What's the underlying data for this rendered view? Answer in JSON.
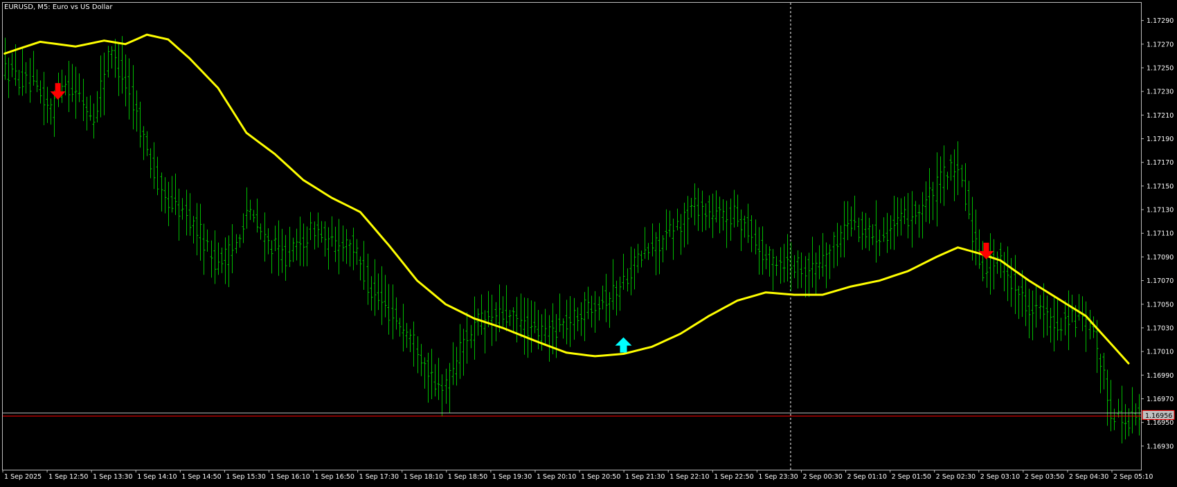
{
  "window": {
    "title": "EURUSD, M5:  Euro vs US Dollar"
  },
  "colors": {
    "background": "#000000",
    "frame": "#c0c0c0",
    "bars": "#00c000",
    "moving_average": "#ffff00",
    "bid_line": "#ff0000",
    "ask_line": "#c0c0c0",
    "price_tag_bg": "#c0c0c0",
    "price_tag_border": "#ff0000",
    "buy_arrow": "#00ffff",
    "sell_arrow": "#ff0000",
    "period_separator": "#ffffff"
  },
  "chart_data": {
    "type": "ohlc",
    "symbol": "EURUSD",
    "timeframe": "M5",
    "ylim": [
      1.1691,
      1.17305
    ],
    "y_ticks": [
      "1.17290",
      "1.17270",
      "1.17250",
      "1.17230",
      "1.17210",
      "1.17190",
      "1.17170",
      "1.17150",
      "1.17130",
      "1.17110",
      "1.17090",
      "1.17070",
      "1.17050",
      "1.17030",
      "1.17010",
      "1.16990",
      "1.16970",
      "1.16950",
      "1.16930"
    ],
    "x_tick_labels": [
      "1 Sep 2025",
      "1 Sep 12:50",
      "1 Sep 13:30",
      "1 Sep 14:10",
      "1 Sep 14:50",
      "1 Sep 15:30",
      "1 Sep 16:10",
      "1 Sep 16:50",
      "1 Sep 17:30",
      "1 Sep 18:10",
      "1 Sep 18:50",
      "1 Sep 19:30",
      "1 Sep 20:10",
      "1 Sep 20:50",
      "1 Sep 21:30",
      "1 Sep 22:10",
      "1 Sep 22:50",
      "1 Sep 23:30",
      "2 Sep 00:30",
      "2 Sep 01:10",
      "2 Sep 01:50",
      "2 Sep 02:30",
      "2 Sep 03:10",
      "2 Sep 03:50",
      "2 Sep 04:30",
      "2 Sep 05:10"
    ],
    "current_price": "1.16956",
    "bid": 1.16956,
    "ask": 1.16958,
    "period_separator_time": "2 Sep 00:00",
    "bars_anchor": [
      {
        "t": 0,
        "p": 1.1725
      },
      {
        "t": 8,
        "p": 1.17235
      },
      {
        "t": 14,
        "p": 1.17215
      },
      {
        "t": 17,
        "p": 1.1724
      },
      {
        "t": 22,
        "p": 1.17225
      },
      {
        "t": 26,
        "p": 1.17205
      },
      {
        "t": 30,
        "p": 1.17265
      },
      {
        "t": 34,
        "p": 1.17245
      },
      {
        "t": 38,
        "p": 1.1721
      },
      {
        "t": 42,
        "p": 1.1717
      },
      {
        "t": 45,
        "p": 1.1714
      },
      {
        "t": 50,
        "p": 1.1713
      },
      {
        "t": 56,
        "p": 1.1711
      },
      {
        "t": 60,
        "p": 1.17085
      },
      {
        "t": 65,
        "p": 1.17095
      },
      {
        "t": 69,
        "p": 1.1713
      },
      {
        "t": 74,
        "p": 1.17105
      },
      {
        "t": 80,
        "p": 1.1709
      },
      {
        "t": 84,
        "p": 1.171
      },
      {
        "t": 88,
        "p": 1.17115
      },
      {
        "t": 92,
        "p": 1.171
      },
      {
        "t": 98,
        "p": 1.17105
      },
      {
        "t": 104,
        "p": 1.1706
      },
      {
        "t": 110,
        "p": 1.1704
      },
      {
        "t": 116,
        "p": 1.1702
      },
      {
        "t": 120,
        "p": 1.16995
      },
      {
        "t": 122,
        "p": 1.16975
      },
      {
        "t": 126,
        "p": 1.1699
      },
      {
        "t": 130,
        "p": 1.1702
      },
      {
        "t": 134,
        "p": 1.17035
      },
      {
        "t": 140,
        "p": 1.1704
      },
      {
        "t": 146,
        "p": 1.17035
      },
      {
        "t": 150,
        "p": 1.17025
      },
      {
        "t": 156,
        "p": 1.1703
      },
      {
        "t": 160,
        "p": 1.17035
      },
      {
        "t": 165,
        "p": 1.1705
      },
      {
        "t": 170,
        "p": 1.17055
      },
      {
        "t": 174,
        "p": 1.17065
      },
      {
        "t": 178,
        "p": 1.17085
      },
      {
        "t": 184,
        "p": 1.171
      },
      {
        "t": 190,
        "p": 1.17115
      },
      {
        "t": 195,
        "p": 1.17135
      },
      {
        "t": 200,
        "p": 1.17125
      },
      {
        "t": 206,
        "p": 1.17125
      },
      {
        "t": 210,
        "p": 1.17115
      },
      {
        "t": 214,
        "p": 1.1709
      },
      {
        "t": 222,
        "p": 1.17085
      },
      {
        "t": 228,
        "p": 1.1708
      },
      {
        "t": 234,
        "p": 1.171
      },
      {
        "t": 238,
        "p": 1.1712
      },
      {
        "t": 243,
        "p": 1.1711
      },
      {
        "t": 248,
        "p": 1.1711
      },
      {
        "t": 253,
        "p": 1.1712
      },
      {
        "t": 258,
        "p": 1.1713
      },
      {
        "t": 262,
        "p": 1.17145
      },
      {
        "t": 266,
        "p": 1.17165
      },
      {
        "t": 270,
        "p": 1.17155
      },
      {
        "t": 273,
        "p": 1.1711
      },
      {
        "t": 276,
        "p": 1.1708
      },
      {
        "t": 280,
        "p": 1.1709
      },
      {
        "t": 284,
        "p": 1.1707
      },
      {
        "t": 288,
        "p": 1.1705
      },
      {
        "t": 292,
        "p": 1.17045
      },
      {
        "t": 296,
        "p": 1.1703
      },
      {
        "t": 300,
        "p": 1.1704
      },
      {
        "t": 304,
        "p": 1.17035
      },
      {
        "t": 306,
        "p": 1.1703
      },
      {
        "t": 309,
        "p": 1.17
      },
      {
        "t": 312,
        "p": 1.1696
      },
      {
        "t": 316,
        "p": 1.1695
      },
      {
        "t": 318,
        "p": 1.16955
      }
    ],
    "moving_average": [
      {
        "t": 0,
        "p": 1.17262
      },
      {
        "t": 10,
        "p": 1.17272
      },
      {
        "t": 20,
        "p": 1.17268
      },
      {
        "t": 28,
        "p": 1.17273
      },
      {
        "t": 34,
        "p": 1.1727
      },
      {
        "t": 40,
        "p": 1.17278
      },
      {
        "t": 46,
        "p": 1.17274
      },
      {
        "t": 52,
        "p": 1.17258
      },
      {
        "t": 60,
        "p": 1.17233
      },
      {
        "t": 68,
        "p": 1.17195
      },
      {
        "t": 76,
        "p": 1.17177
      },
      {
        "t": 84,
        "p": 1.17155
      },
      {
        "t": 92,
        "p": 1.1714
      },
      {
        "t": 100,
        "p": 1.17128
      },
      {
        "t": 108,
        "p": 1.171
      },
      {
        "t": 116,
        "p": 1.1707
      },
      {
        "t": 124,
        "p": 1.1705
      },
      {
        "t": 132,
        "p": 1.17038
      },
      {
        "t": 140,
        "p": 1.1703
      },
      {
        "t": 150,
        "p": 1.17018
      },
      {
        "t": 158,
        "p": 1.17009
      },
      {
        "t": 166,
        "p": 1.17006
      },
      {
        "t": 174,
        "p": 1.17008
      },
      {
        "t": 182,
        "p": 1.17014
      },
      {
        "t": 190,
        "p": 1.17025
      },
      {
        "t": 198,
        "p": 1.1704
      },
      {
        "t": 206,
        "p": 1.17053
      },
      {
        "t": 214,
        "p": 1.1706
      },
      {
        "t": 222,
        "p": 1.17058
      },
      {
        "t": 230,
        "p": 1.17058
      },
      {
        "t": 238,
        "p": 1.17065
      },
      {
        "t": 246,
        "p": 1.1707
      },
      {
        "t": 254,
        "p": 1.17078
      },
      {
        "t": 262,
        "p": 1.1709
      },
      {
        "t": 268,
        "p": 1.17098
      },
      {
        "t": 274,
        "p": 1.17093
      },
      {
        "t": 280,
        "p": 1.17087
      },
      {
        "t": 288,
        "p": 1.1707
      },
      {
        "t": 296,
        "p": 1.17055
      },
      {
        "t": 304,
        "p": 1.1704
      },
      {
        "t": 310,
        "p": 1.1702
      },
      {
        "t": 316,
        "p": 1.17
      }
    ],
    "signals": [
      {
        "type": "sell",
        "t": 15,
        "p": 1.1723
      },
      {
        "type": "buy",
        "t": 174,
        "p": 1.17015
      },
      {
        "type": "sell",
        "t": 276,
        "p": 1.17095
      }
    ]
  }
}
